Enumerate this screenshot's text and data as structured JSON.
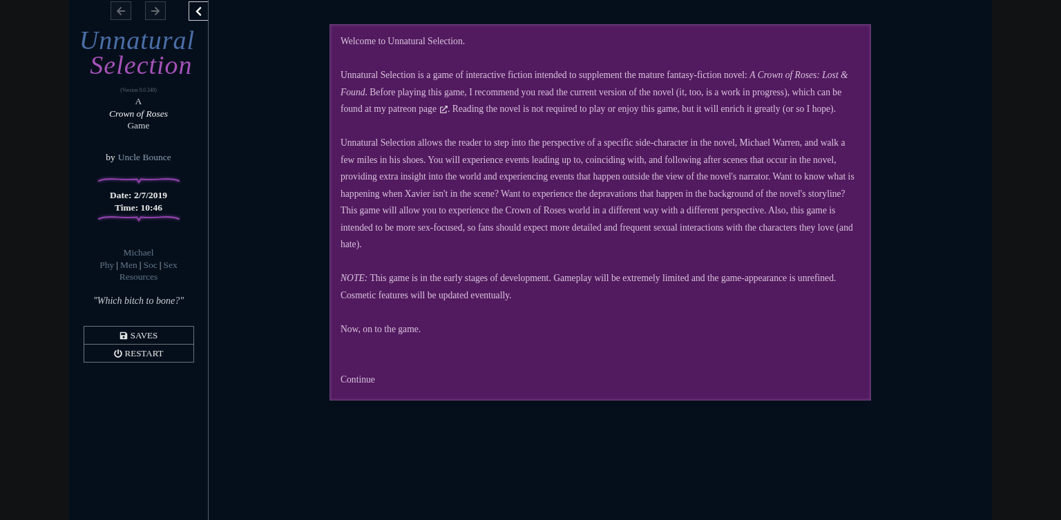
{
  "sidebar": {
    "history_buttons": [
      {
        "kind": "back",
        "disabled": true
      },
      {
        "kind": "forward",
        "disabled": true
      }
    ],
    "logo": {
      "line_1": "Unnatural",
      "line_2": "Selection"
    },
    "version": "(Version 0.0.340)",
    "story_subtitle": {
      "prefix": "A",
      "title": "Crown of Roses",
      "suffix": "Game"
    },
    "byline": {
      "label": "by",
      "author": "Uncle Bounce"
    },
    "clock": {
      "date": "Date: 2/7/2019",
      "time": "Time: 10:46"
    },
    "character": {
      "name": "Michael",
      "stat_links": [
        {
          "label": "Phy"
        },
        {
          "label": "Men"
        },
        {
          "label": "Soc"
        },
        {
          "label": "Sex"
        }
      ],
      "separators": [
        "|",
        "|",
        "|"
      ],
      "resources": "Resources"
    },
    "quote": "\"Which bitch to bone?\"",
    "menu_buttons": [
      {
        "kind": "saves",
        "label": "SAVES"
      },
      {
        "kind": "restart",
        "label": "RESTART"
      }
    ]
  },
  "passage": {
    "welcome": "Welcome to Unnatural Selection.",
    "intro": {
      "before_link": "Unnatural Selection is a game of interactive fiction intended to supplement the mature fantasy-fiction novel: *A Crown of Roses: Lost & Found*. Before playing this game, I recommend you read the current version of the novel (it, too, is a work in progress), which can be found at my ",
      "link": "patreon page",
      "after_link": ". Reading the novel is not required to play or enjoy this game, but it will enrich it greatly (or so I hope)."
    },
    "description": "Unnatural Selection allows the reader to step into the perspective of a specific side-character in the novel, Michael Warren, and walk a few miles in his shoes. You will experience events leading up to, coinciding with, and following after scenes that occur in the novel, providing extra insight into the world and experiencing events that happen outside the view of the novel's narrator. Want to know what is happening when Xavier isn't in the scene? Want to experience the depravations that happen in the background of the novel's storyline? This game will allow you to experience the Crown of Roses world in a different way with a different perspective. Also, this game is intended to be more sex-focused, so fans should expect more detailed and frequent sexual interactions with the characters they love (and hate).",
    "note": "*NOTE:* This game is in the early stages of development. Gameplay will be extremely limited and the game-appearance is unrefined. Cosmetic features will be updated eventually.",
    "closing": "Now, on to the game.",
    "continue_link": "Continue"
  }
}
